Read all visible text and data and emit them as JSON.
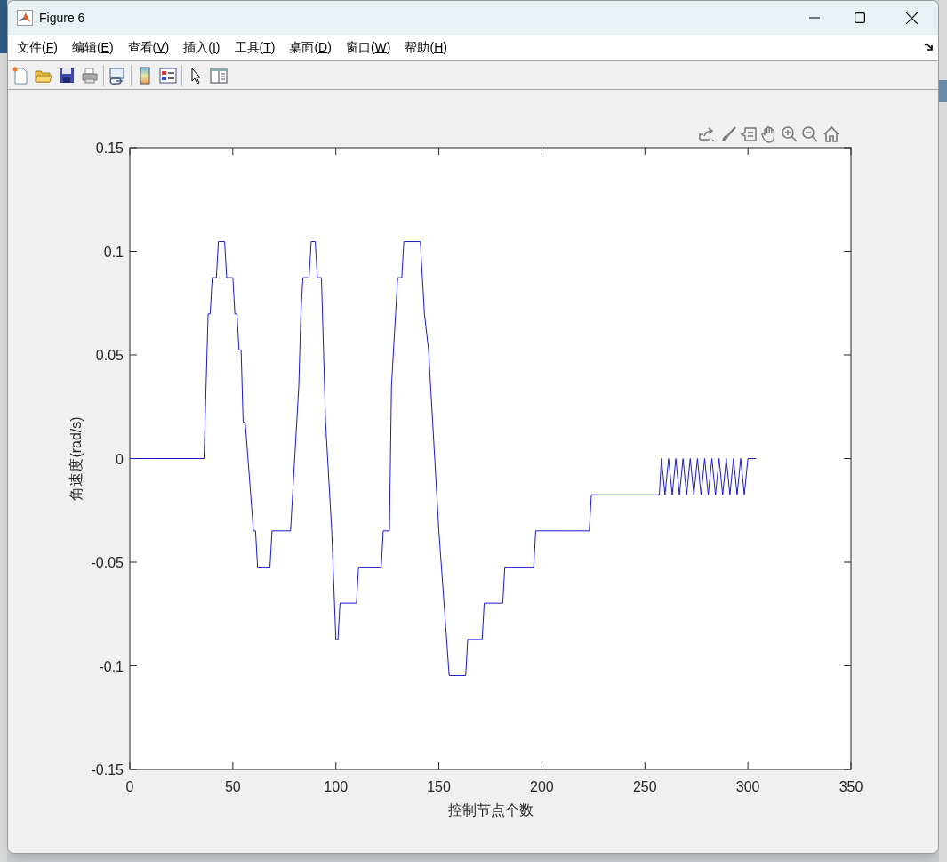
{
  "window": {
    "title": "Figure 6"
  },
  "menu": [
    {
      "before": "文件(",
      "key": "F",
      "after": ")"
    },
    {
      "before": "编辑(",
      "key": "E",
      "after": ")"
    },
    {
      "before": "查看(",
      "key": "V",
      "after": ")"
    },
    {
      "before": "插入(",
      "key": "I",
      "after": ")"
    },
    {
      "before": "工具(",
      "key": "T",
      "after": ")"
    },
    {
      "before": "桌面(",
      "key": "D",
      "after": ")"
    },
    {
      "before": "窗口(",
      "key": "W",
      "after": ")"
    },
    {
      "before": "帮助(",
      "key": "H",
      "after": ")"
    }
  ],
  "axes": {
    "chart_data": {
      "type": "line",
      "xlabel": "控制节点个数",
      "ylabel": "角速度(rad/s)",
      "x": [
        0,
        36,
        37,
        38,
        39,
        40,
        42,
        43,
        46,
        47,
        50,
        51,
        52,
        53,
        54,
        55,
        56,
        60,
        61,
        62,
        68,
        69,
        78,
        82,
        83,
        84,
        87,
        88,
        90,
        91,
        93,
        94,
        95,
        98,
        100,
        101,
        102,
        110,
        111,
        122,
        123,
        126,
        127,
        129,
        130,
        132,
        133,
        141,
        142,
        143,
        145,
        147,
        150,
        155,
        163,
        164,
        171,
        172,
        181,
        182,
        196,
        197,
        223,
        224,
        257,
        258,
        259.75,
        261.5,
        263.25,
        265,
        266.75,
        268.5,
        270.25,
        272,
        273.75,
        275.5,
        277.25,
        279,
        280.75,
        282.5,
        284.25,
        286,
        287.75,
        289.5,
        291.25,
        293,
        294.75,
        296.5,
        298.25,
        300,
        304
      ],
      "series": [
        {
          "color": "#1a1acc",
          "values": [
            0,
            0,
            0.0349,
            0.0698,
            0.0698,
            0.0873,
            0.0873,
            0.1047,
            0.1047,
            0.0873,
            0.0873,
            0.0698,
            0.0698,
            0.0524,
            0.0524,
            0.0175,
            0.0175,
            -0.0349,
            -0.0349,
            -0.0524,
            -0.0524,
            -0.0349,
            -0.0349,
            0.0349,
            0.0698,
            0.0873,
            0.0873,
            0.1047,
            0.1047,
            0.0873,
            0.0873,
            0.0524,
            0.0175,
            -0.0349,
            -0.0873,
            -0.0873,
            -0.0698,
            -0.0698,
            -0.0524,
            -0.0524,
            -0.0349,
            -0.0349,
            0.0349,
            0.0698,
            0.0873,
            0.0873,
            0.1047,
            0.1047,
            0.0873,
            0.0698,
            0.0524,
            0.0175,
            -0.0349,
            -0.1047,
            -0.1047,
            -0.0873,
            -0.0873,
            -0.0698,
            -0.0698,
            -0.0524,
            -0.0524,
            -0.0349,
            -0.0349,
            -0.0175,
            -0.0175,
            0,
            -0.0175,
            0,
            -0.0175,
            0,
            -0.0175,
            0,
            -0.0175,
            0,
            -0.0175,
            0,
            -0.0175,
            0,
            -0.0175,
            0,
            -0.0175,
            0,
            -0.0175,
            0,
            -0.0175,
            0,
            -0.0175,
            0,
            -0.0175,
            0,
            0
          ]
        }
      ],
      "xlim": [
        0,
        350
      ],
      "ylim": [
        -0.15,
        0.15
      ],
      "xticks": [
        0,
        50,
        100,
        150,
        200,
        250,
        300,
        350
      ],
      "yticks": [
        -0.15,
        -0.1,
        -0.05,
        0,
        0.05,
        0.1,
        0.15
      ]
    }
  }
}
